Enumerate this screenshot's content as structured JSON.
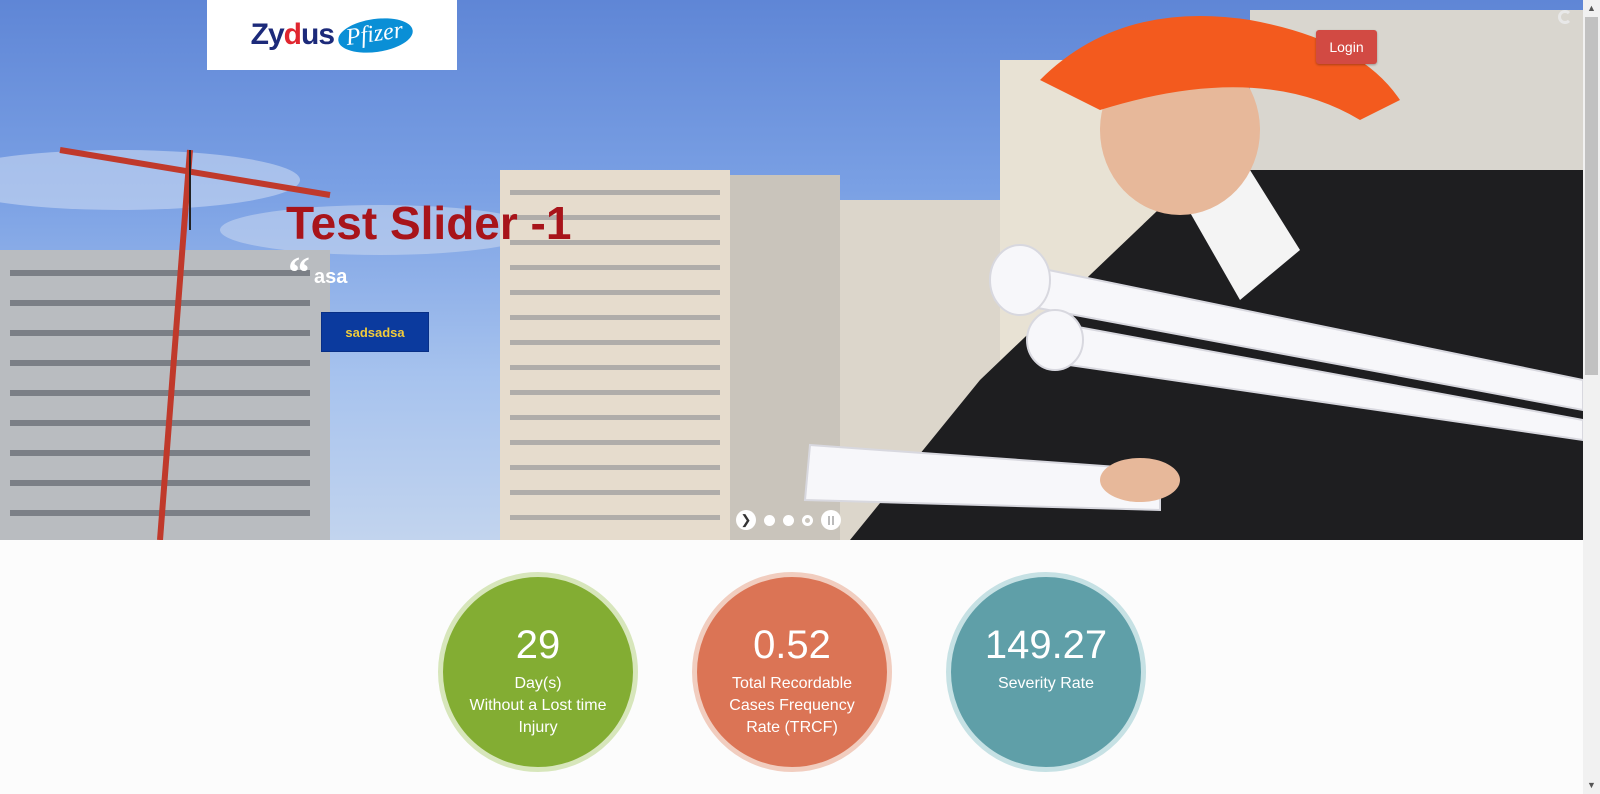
{
  "header": {
    "logo_primary_left": "Zy",
    "logo_primary_mid": "d",
    "logo_primary_right": "us",
    "logo_partner": "Pfizer",
    "login_label": "Login"
  },
  "slider": {
    "title": "Test Slider -1",
    "quote_mark": "“",
    "quote_text": "asa",
    "cta_label": "sadsadsa",
    "slide_count": 3,
    "active_slide_index": 2
  },
  "stats": [
    {
      "value": "29",
      "label_lines": [
        "Day(s)",
        "Without a Lost time",
        "Injury"
      ],
      "color": "#83ad33"
    },
    {
      "value": "0.52",
      "label_lines": [
        "Total Recordable",
        "Cases Frequency",
        "Rate (TRCF)"
      ],
      "color": "#db7455"
    },
    {
      "value": "149.27",
      "label_lines": [
        "Severity Rate"
      ],
      "color": "#5f9fa8"
    }
  ],
  "icons": {
    "next": "chevron-right-icon",
    "pause": "pause-icon",
    "loading": "spinner-icon"
  }
}
